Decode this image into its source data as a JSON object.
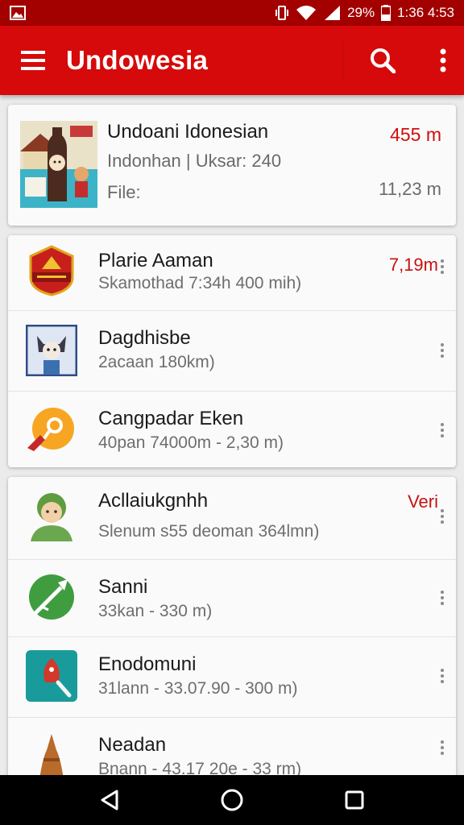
{
  "status_bar": {
    "battery_text": "29%",
    "time": "1:36 4:53"
  },
  "app_bar": {
    "title": "Undowesia"
  },
  "featured": {
    "title": "Undoani Idonesian",
    "subtitle": "Indonhan | Uksar:  240",
    "label": "File:",
    "distance": "455 m",
    "size": "11,23 m"
  },
  "list_group_1": [
    {
      "name": "Plarie Aaman",
      "details": "Skamothad 7:34h 400 mih)",
      "meta": "7,19m"
    },
    {
      "name": "Dagdhisbe",
      "details": "2acaan 180km)",
      "meta": ""
    },
    {
      "name": "Cangpadar Eken",
      "details": "40pan 74000m - 2,30 m)",
      "meta": ""
    }
  ],
  "list_group_2": [
    {
      "name": "Acllaiukgnhh",
      "details": "Slenum s55 deoman 364lmn)",
      "meta": "Veri"
    },
    {
      "name": "Sanni",
      "details": "33kan - 330 m)",
      "meta": ""
    },
    {
      "name": "Enodomuni",
      "details": "31lann - 33.07.90 - 300 m)",
      "meta": ""
    },
    {
      "name": "Neadan",
      "details": "Bnann - 43.17 20e - 33 rm)",
      "meta": ""
    }
  ],
  "colors": {
    "app_bar": "#d60a0a",
    "status_bar": "#a30000",
    "accent_text": "#d00d0d"
  }
}
